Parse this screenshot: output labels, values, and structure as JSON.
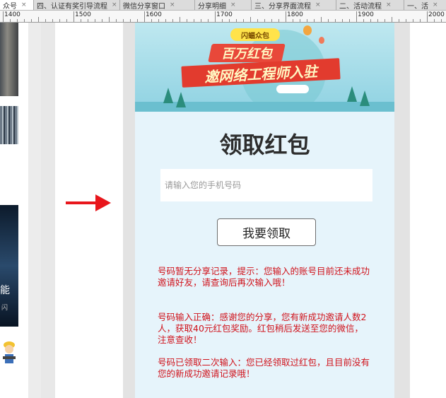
{
  "tabs": [
    {
      "label": "众号",
      "active": true
    },
    {
      "label": "四、认证有奖引导流程",
      "active": false
    },
    {
      "label": "微信分享窗口",
      "active": false
    },
    {
      "label": "分享明细",
      "active": false
    },
    {
      "label": "三、分享界面流程",
      "active": false
    },
    {
      "label": "二、活动流程",
      "active": false
    },
    {
      "label": "一、活",
      "active": false
    }
  ],
  "tab_close_glyph": "×",
  "ruler": {
    "labels": [
      "1400",
      "1500",
      "1600",
      "1700",
      "1800",
      "1900",
      "2000"
    ]
  },
  "left_thumbnails": {
    "caption": "能",
    "sub": "闪"
  },
  "banner": {
    "badge": "闪蝠众包",
    "line1": "百万红包",
    "line2": "邀网络工程师入驻"
  },
  "page": {
    "title": "领取红包",
    "phone_placeholder": "请输入您的手机号码",
    "phone_value": "",
    "claim_button": "我要领取"
  },
  "messages": [
    "号码暂无分享记录，提示：您输入的账号目前还未成功邀请好友，请查询后再次输入哦！",
    "号码输入正确：感谢您的分享，您有新成功邀请人数2人，获取40元红包奖励。红包稍后发送至您的微信，注意查收！",
    "号码已领取二次输入：您已经领取过红包，且目前没有您的新成功邀请记录哦！"
  ],
  "colors": {
    "message_red": "#d0121b",
    "arrow_red": "#e8161c",
    "phone_bg": "#e6f4fb"
  },
  "icons": {
    "arrow": "right-arrow-icon",
    "tab_close": "close-icon"
  }
}
